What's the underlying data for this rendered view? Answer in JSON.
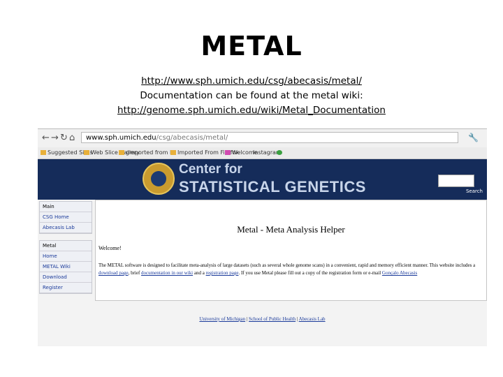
{
  "slide": {
    "title": "METAL",
    "url": "http://www.sph.umich.edu/csg/abecasis/metal/",
    "doc_note": "Documentation can be found at the metal wiki:",
    "wiki_url": "http://genome.sph.umich.edu/wiki/Metal_Documentation"
  },
  "browser": {
    "back": "←",
    "forward": "→",
    "reload": "↻",
    "home": "⌂",
    "url_domain": "www.sph.umich.edu",
    "url_path": "/csg/abecasis/metal/",
    "menu": "🔧",
    "bookmarks": [
      "Suggested Sites",
      "Web Slice Gallery",
      "gmported from IE",
      "Imported From Firefox",
      "Welcome",
      "Instagram"
    ]
  },
  "site": {
    "banner_line1": "Center for",
    "banner_line2": "STATISTICAL GENETICS",
    "search_label": "Search",
    "sidebar_group1": [
      "Main",
      "CSG Home",
      "Abecasis Lab"
    ],
    "sidebar_group2": [
      "Metal",
      "Home",
      "METAL Wiki",
      "Download",
      "Register"
    ],
    "page_title": "Metal - Meta Analysis Helper",
    "welcome": "Welcome!",
    "para_start": "The METAL software is designed to facilitate meta-analysis of large datasets (such as several whole genome scans) in a convenient, rapid and memory efficient manner. This website includes a",
    "link_download": "download page",
    "para_mid1": ", brief",
    "link_docs": "documentation in our wiki",
    "para_mid2": "and a",
    "link_reg": "registration page",
    "para_end": ". If you use Metal please fill out a copy of the registration form or e-mail",
    "link_email": "Gonçalo Abecasis",
    "footer_links": [
      "University of Michigan",
      "School of Public Health",
      "Abecasis Lab"
    ],
    "sep": "|"
  }
}
